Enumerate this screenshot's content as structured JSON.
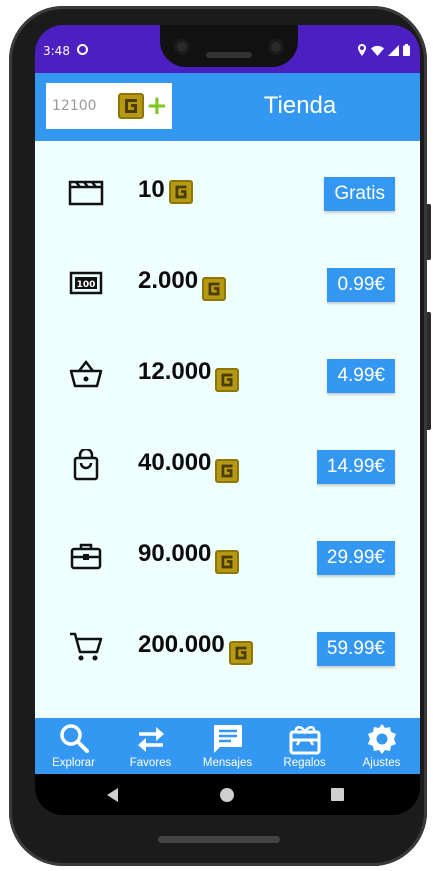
{
  "status_bar": {
    "time": "3:48",
    "icons": [
      "dnd-icon",
      "location-icon",
      "wifi-icon",
      "signal-icon",
      "battery-icon"
    ]
  },
  "header": {
    "balance": "12100",
    "title": "Tienda",
    "coin_icon": "coin-icon",
    "add_icon": "plus-icon"
  },
  "shop": {
    "items": [
      {
        "icon": "clapperboard-icon",
        "amount": "10",
        "price": "Gratis"
      },
      {
        "icon": "money-icon",
        "amount": "2.000",
        "price": "0.99€"
      },
      {
        "icon": "basket-icon",
        "amount": "12.000",
        "price": "4.99€"
      },
      {
        "icon": "bag-icon",
        "amount": "40.000",
        "price": "14.99€"
      },
      {
        "icon": "briefcase-icon",
        "amount": "90.000",
        "price": "29.99€"
      },
      {
        "icon": "cart-icon",
        "amount": "200.000",
        "price": "59.99€"
      }
    ]
  },
  "bottom_nav": {
    "items": [
      {
        "icon": "search-icon",
        "label": "Explorar"
      },
      {
        "icon": "swap-icon",
        "label": "Favores"
      },
      {
        "icon": "message-icon",
        "label": "Mensajes"
      },
      {
        "icon": "gift-icon",
        "label": "Regalos"
      },
      {
        "icon": "gear-icon",
        "label": "Ajustes"
      }
    ]
  },
  "colors": {
    "accent": "#3498f3",
    "status_bar": "#4b1fc0",
    "content_bg": "#effffe",
    "coin": "#b59912",
    "plus": "#7fc51f"
  }
}
